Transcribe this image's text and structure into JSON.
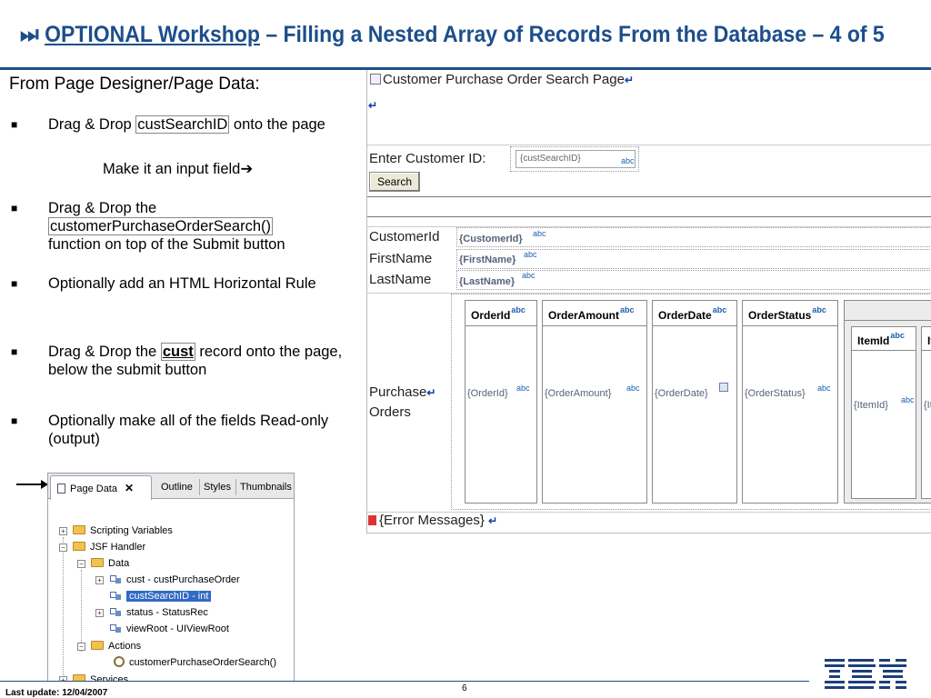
{
  "slide": {
    "title_prefix_icon": "skip-forward-icon",
    "title_optional": "OPTIONAL Workshop",
    "title_rest": " – Filling a Nested Array of Records From the Database – 4 of 5",
    "intro": "From Page Designer/Page Data:",
    "bullets": [
      {
        "pre": "Drag & Drop ",
        "code": "custSearchID",
        "post": " onto the page"
      },
      {
        "pre": "Drag & Drop the ",
        "code": "customerPurchaseOrderSearch()",
        "post": " function on top of the Submit button"
      },
      {
        "pre": "Optionally add an HTML Horizontal Rule"
      },
      {
        "pre": "Drag & Drop the ",
        "code": "cust",
        "post": " record onto the page, below the submit button"
      },
      {
        "pre": "Optionally make all of the fields Read-only (output)"
      }
    ],
    "sub_note": "Make it an input field",
    "sub_note_icon": "right-arrow-icon"
  },
  "page_data_panel": {
    "tabs": [
      "Page Data",
      "Outline",
      "Styles",
      "Thumbnails"
    ],
    "tree": [
      {
        "label": "Scripting Variables",
        "indent": 0,
        "icon": "folder-icon",
        "expander": "+"
      },
      {
        "label": "JSF Handler",
        "indent": 0,
        "icon": "folder-icon",
        "expander": "-"
      },
      {
        "label": "Data",
        "indent": 1,
        "icon": "folder-icon",
        "expander": "-"
      },
      {
        "label": "cust - custPurchaseOrder",
        "indent": 2,
        "icon": "variable-icon",
        "expander": "+"
      },
      {
        "label": "custSearchID - int",
        "indent": 2,
        "icon": "variable-icon",
        "expander": "",
        "selected": true
      },
      {
        "label": "status - StatusRec",
        "indent": 2,
        "icon": "variable-icon",
        "expander": "+"
      },
      {
        "label": "viewRoot - UIViewRoot",
        "indent": 2,
        "icon": "variable-icon",
        "expander": ""
      },
      {
        "label": "Actions",
        "indent": 1,
        "icon": "folder-icon",
        "expander": "-"
      },
      {
        "label": "customerPurchaseOrderSearch()",
        "indent": 2,
        "icon": "gear-icon",
        "expander": ""
      },
      {
        "label": "Services",
        "indent": 0,
        "icon": "folder-icon",
        "expander": "+"
      }
    ]
  },
  "designer": {
    "page_heading": "Customer Purchase Order Search Page",
    "enter_label": "Enter Customer ID:",
    "input_value": "{custSearchID}",
    "abc": "abc",
    "search_button": "Search",
    "fields": [
      {
        "label": "CustomerId",
        "value": "{CustomerId}"
      },
      {
        "label": "FirstName",
        "value": "{FirstName}"
      },
      {
        "label": "LastName",
        "value": "{LastName}"
      }
    ],
    "orders_label_1": "Purchase",
    "orders_label_2": "Orders",
    "columns": [
      {
        "head": "OrderId",
        "cell": "{OrderId}"
      },
      {
        "head": "OrderAmount",
        "cell": "{OrderAmount}"
      },
      {
        "head": "OrderDate",
        "cell": "{OrderDate}"
      },
      {
        "head": "OrderStatus",
        "cell": "{OrderStatus}"
      }
    ],
    "nested_columns": [
      {
        "head": "ItemId",
        "cell": "{ItemId}"
      },
      {
        "head": "It",
        "cell": "{It"
      }
    ],
    "error_messages": "{Error Messages}"
  },
  "footer": {
    "last_update": "Last update: 12/04/2007",
    "page_number": "6",
    "logo_text": "IBM"
  }
}
